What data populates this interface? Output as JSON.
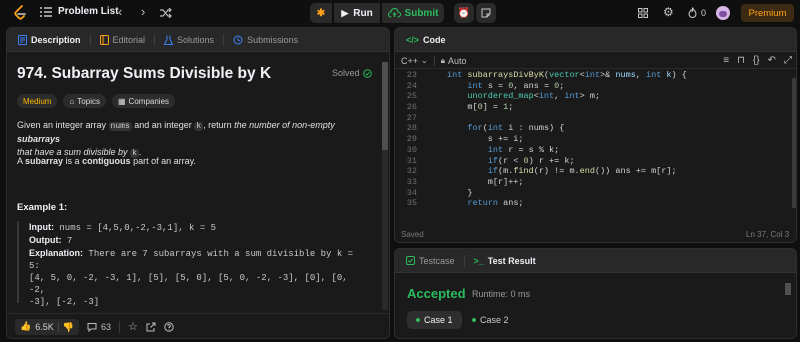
{
  "topbar": {
    "problem_list": "Problem List",
    "run": "Run",
    "submit": "Submit",
    "streak": "0",
    "premium": "Premium",
    "icons": [
      "leetcode-logo-icon",
      "list-icon",
      "chevron-left-icon",
      "chevron-right-icon",
      "shuffle-icon",
      "debug-icon",
      "play-icon",
      "cloud-upload-icon",
      "alarm-icon",
      "note-icon",
      "grid-icon",
      "gear-icon",
      "fire-icon",
      "avatar"
    ]
  },
  "desc_tabs": [
    "Description",
    "Editorial",
    "Solutions",
    "Submissions"
  ],
  "problem": {
    "title": "974. Subarray Sums Divisible by K",
    "status": "Solved",
    "difficulty": "Medium",
    "topics": "Topics",
    "companies": "Companies",
    "statement_1": "Given an integer array ",
    "statement_nums": "nums",
    "statement_2": " and an integer ",
    "statement_k": "k",
    "statement_3": ", return ",
    "statement_4": "the number of non-empty ",
    "statement_5": "subarrays",
    "statement_6": "that have a sum divisible by ",
    "statement_7": "k",
    "statement_8": ".",
    "def_1": "A ",
    "def_2": "subarray",
    "def_3": " is a ",
    "def_4": "contiguous",
    "def_5": " part of an array.",
    "example_heading": "Example 1:",
    "input_label": "Input:",
    "input_value": " nums = [4,5,0,-2,-3,1], k = 5",
    "output_label": "Output:",
    "output_value": " 7",
    "expl_label": "Explanation:",
    "expl_line1": " There are 7 subarrays with a sum divisible by k =",
    "expl_line2": "5:",
    "expl_line3": "[4, 5, 0, -2, -3, 1], [5], [5, 0], [5, 0, -2, -3], [0], [0, -2,",
    "expl_line4": "-3], [-2, -3]"
  },
  "desc_footer": {
    "likes": "6.5K",
    "comments": "63"
  },
  "code_panel": {
    "title": "Code",
    "language": "C++",
    "mode": "Auto",
    "status": "Saved",
    "position": "Ln 37, Col 3",
    "lines": [
      {
        "n": "23",
        "code": "int subarraysDivByK(vector<int>& nums, int k) {"
      },
      {
        "n": "24",
        "code": "    int s = 0, ans = 0;"
      },
      {
        "n": "25",
        "code": "    unordered_map<int, int> m;"
      },
      {
        "n": "26",
        "code": "    m[0] = 1;"
      },
      {
        "n": "27",
        "code": ""
      },
      {
        "n": "28",
        "code": "    for(int i : nums) {"
      },
      {
        "n": "29",
        "code": "        s += i;"
      },
      {
        "n": "30",
        "code": "        int r = s % k;"
      },
      {
        "n": "31",
        "code": "        if(r < 0) r += k;"
      },
      {
        "n": "32",
        "code": "        if(m.find(r) != m.end()) ans += m[r];"
      },
      {
        "n": "33",
        "code": "        m[r]++;"
      },
      {
        "n": "34",
        "code": "    }"
      },
      {
        "n": "35",
        "code": "    return ans;"
      }
    ]
  },
  "test_panel": {
    "tab_testcase": "Testcase",
    "tab_result": "Test Result",
    "verdict": "Accepted",
    "runtime": "Runtime: 0 ms",
    "case1": "Case 1",
    "case2": "Case 2"
  },
  "colors": {
    "accent": "#ffa116",
    "success": "#2cbb5d",
    "medium": "#ffb800"
  }
}
